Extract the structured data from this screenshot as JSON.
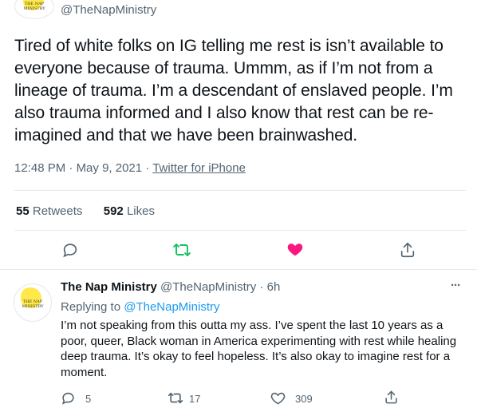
{
  "tweet": {
    "handle": "@TheNapMinistry",
    "avatar_text": "THE NAP MINISTRY",
    "text": "Tired of white folks on IG telling me rest is isn’t available to everyone because of trauma. Ummm, as if I’m not from a lineage of trauma. I’m a descendant of enslaved people. I’m also trauma informed and I also know that rest can be re-imagined and that we have been brainwashed.",
    "time": "12:48 PM",
    "date": "May 9, 2021",
    "separator": "·",
    "source": "Twitter for iPhone",
    "retweets_count": "55",
    "retweets_label": "Retweets",
    "likes_count": "592",
    "likes_label": "Likes",
    "icons": {
      "reply": "reply-icon",
      "retweet": "retweet-icon",
      "like": "like-icon",
      "share": "share-icon"
    },
    "colors": {
      "retweet": "#17bf63",
      "like": "#f91880",
      "link": "#1d9bf0",
      "muted": "#536471"
    }
  },
  "reply": {
    "name": "The Nap Ministry",
    "handle": "@TheNapMinistry",
    "time": "6h",
    "separator": "·",
    "replying_prefix": "Replying to",
    "replying_handle": "@TheNapMinistry",
    "text": "I’m not speaking from this outta my ass. I’ve spent the last 10 years as a poor, queer, Black woman in America experimenting with rest while healing deep trauma. It’s okay to feel hopeless. It’s also okay to imagine rest for a moment.",
    "reply_count": "5",
    "retweet_count": "17",
    "like_count": "309",
    "more": "···"
  }
}
